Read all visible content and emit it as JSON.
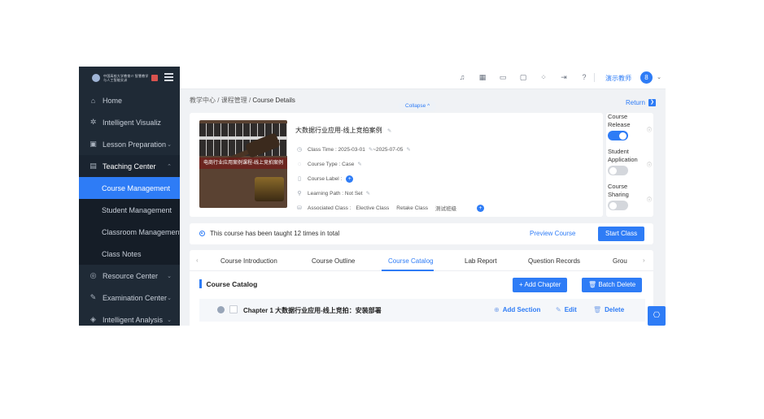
{
  "sidebar": {
    "logo_text": "中国高校大学教育IT 智慧教学与人工智能实训",
    "items": [
      {
        "icon": "⌂",
        "label": "Home",
        "arrow": ""
      },
      {
        "icon": "✲",
        "label": "Intelligent Visualiz",
        "arrow": ""
      },
      {
        "icon": "▣",
        "label": "Lesson Preparation",
        "arrow": "⌄"
      },
      {
        "icon": "▤",
        "label": "Teaching Center",
        "arrow": "⌃"
      },
      {
        "icon": "",
        "label": "Course Management",
        "arrow": ""
      },
      {
        "icon": "",
        "label": "Student Management",
        "arrow": ""
      },
      {
        "icon": "",
        "label": "Classroom Management",
        "arrow": ""
      },
      {
        "icon": "",
        "label": "Class Notes",
        "arrow": ""
      },
      {
        "icon": "◎",
        "label": "Resource Center",
        "arrow": "⌄"
      },
      {
        "icon": "✎",
        "label": "Examination Center",
        "arrow": "⌄"
      },
      {
        "icon": "◈",
        "label": "Intelligent Analysis",
        "arrow": "⌄"
      }
    ]
  },
  "header": {
    "user_name": "演示教师",
    "avatar_glyph": "8",
    "icons": [
      "bell-icon",
      "calendar-icon",
      "message-icon",
      "document-icon",
      "fullscreen-icon",
      "export-icon",
      "help-icon"
    ]
  },
  "breadcrumb": {
    "part1": "教学中心",
    "sep": "/",
    "part2": "课程管理",
    "current": "Course Details"
  },
  "collapse_label": "Collapse ^",
  "return_label": "Return",
  "course": {
    "cover_banner": "电商行业应用案例课程-线上竞拍案例",
    "title": "大数据行业应用-线上竞拍案例",
    "class_time": "Class Time : 2025-03-01",
    "class_time_end": "~2025-07-05",
    "course_type": "Course Type : Case",
    "course_label": "Course Label :",
    "learning_path": "Learning Path :   Not Set",
    "associated_class": "Associated Class :",
    "classes": [
      "Elective Class",
      "Retake Class",
      "测试班级"
    ]
  },
  "toggles": [
    {
      "label": "Course Release",
      "on": true
    },
    {
      "label": "Student Application",
      "on": false
    },
    {
      "label": "Course Sharing",
      "on": false
    }
  ],
  "taught": {
    "text": "This course has been taught 12 times in total",
    "preview": "Preview Course",
    "start": "Start Class"
  },
  "tabs": [
    "Course Introduction",
    "Course Outline",
    "Course Catalog",
    "Lab Report",
    "Question Records",
    "Grou"
  ],
  "active_tab": "Course Catalog",
  "catalog": {
    "title": "Course Catalog",
    "add_chapter": "+ Add Chapter",
    "batch_delete": "Batch Delete",
    "chapter_title": "Chapter 1  大数据行业应用-线上竞拍：安装部署",
    "add_section": "Add Section",
    "edit": "Edit",
    "delete": "Delete"
  },
  "colors": {
    "primary": "#2e7cf6",
    "sidebar_bg": "#1f2a36"
  }
}
